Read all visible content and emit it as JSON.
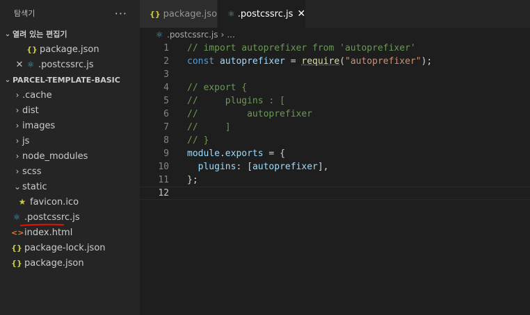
{
  "sidebar": {
    "title": "탐색기",
    "more": "···",
    "open_editors": {
      "title": "열려 있는 편집기",
      "items": [
        {
          "icon": "{}",
          "label": "package.json"
        },
        {
          "icon": "⚛",
          "label": ".postcssrc.js",
          "close": "✕"
        }
      ]
    },
    "project": {
      "title": "PARCEL-TEMPLATE-BASIC",
      "folders": [
        ".cache",
        "dist",
        "images",
        "js",
        "node_modules",
        "scss",
        "static"
      ],
      "static_child": "favicon.ico",
      "files": [
        ".postcssrc.js",
        "index.html",
        "package-lock.json",
        "package.json"
      ]
    },
    "icons": {
      "json": "{}",
      "react": "⚛",
      "html": "<>",
      "star": "★",
      "chevron_right": "›",
      "chevron_down": "⌄"
    }
  },
  "tabs": [
    {
      "label": "package.json",
      "icon": "{}",
      "active": false
    },
    {
      "label": ".postcssrc.js",
      "icon": "⚛",
      "active": true,
      "close": "✕"
    }
  ],
  "breadcrumb": {
    "file": ".postcssrc.js",
    "sep": "›",
    "rest": "..."
  },
  "line_numbers": [
    "1",
    "2",
    "3",
    "4",
    "5",
    "6",
    "7",
    "8",
    "9",
    "10",
    "11",
    "12"
  ],
  "colors": {
    "comment": "#6a9955",
    "keyword": "#569cd6",
    "variable": "#9cdcfe",
    "function": "#dcdcaa",
    "string": "#ce9178",
    "underline": "#e51400"
  }
}
